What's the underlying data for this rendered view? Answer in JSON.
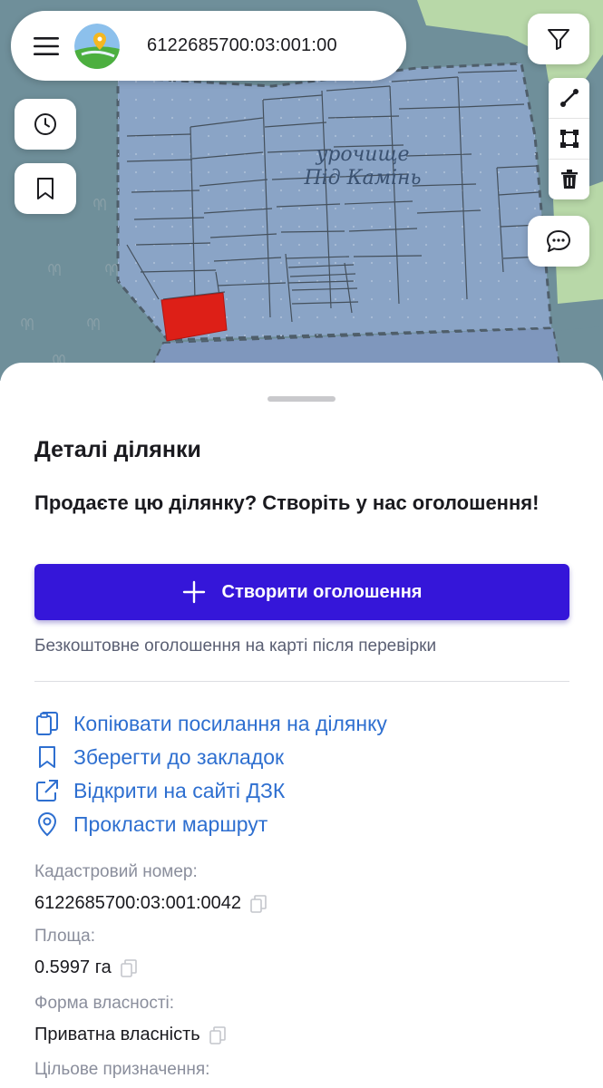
{
  "map": {
    "place_label_line1": "урочище",
    "place_label_line2": "Під Камінь",
    "colors": {
      "base": "#6f8f9a",
      "parcels": "#8aa4c6",
      "forest": "#b8d8a8",
      "selected_parcel": "#dd1f17"
    }
  },
  "search": {
    "query": "6122685700:03:001:00"
  },
  "icons": {
    "menu": "hamburger-menu-icon",
    "logo": "map-logo-icon",
    "history": "clock-icon",
    "bookmark": "bookmark-icon",
    "filter": "filter-icon",
    "line": "draw-line-icon",
    "polygon": "draw-polygon-icon",
    "trash": "trash-icon",
    "chat": "chat-icon"
  },
  "sheet": {
    "title": "Деталі ділянки",
    "sell_prompt": "Продаєте цю ділянку? Створіть у нас оголошення!",
    "create_ad_label": "Створити оголошення",
    "free_note": "Безкоштовне оголошення на карті після перевірки",
    "accent_color": "#3516d9",
    "link_color": "#2e6fd0",
    "actions": [
      {
        "label": "Копіювати посилання на ділянку",
        "icon": "copy-link-icon"
      },
      {
        "label": "Зберегти до закладок",
        "icon": "bookmark-icon"
      },
      {
        "label": "Відкрити на сайті ДЗК",
        "icon": "external-link-icon"
      },
      {
        "label": "Прокласти маршрут",
        "icon": "location-pin-icon"
      }
    ],
    "fields": [
      {
        "label": "Кадастровий номер:",
        "value": "6122685700:03:001:0042"
      },
      {
        "label": "Площа:",
        "value": "0.5997 га"
      },
      {
        "label": "Форма власності:",
        "value": "Приватна власність"
      },
      {
        "label": "Цільове призначення:",
        "value": ""
      }
    ]
  }
}
